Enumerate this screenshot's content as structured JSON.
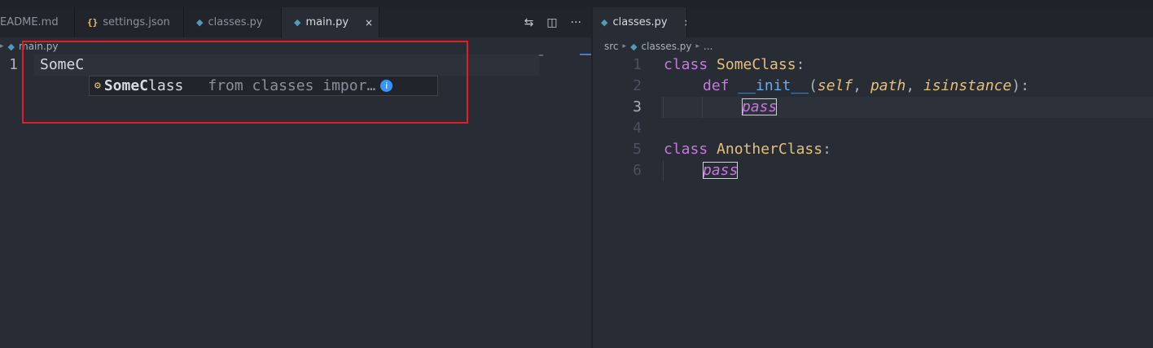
{
  "left_tabs": [
    {
      "label": "EADME.md",
      "icon": "markdown-icon"
    },
    {
      "label": "settings.json",
      "icon": "{}",
      "icon_name": "json-icon"
    },
    {
      "label": "classes.py",
      "icon": "python-icon"
    },
    {
      "label": "main.py",
      "icon": "python-icon",
      "active": true,
      "close": "×"
    }
  ],
  "left_actions": {
    "compare": "⇆",
    "split": "◫",
    "more": "···"
  },
  "right_tabs": [
    {
      "label": "classes.py",
      "icon": "python-icon",
      "active": true,
      "close": "×"
    }
  ],
  "left_breadcrumb": {
    "file": "main.py"
  },
  "right_breadcrumb": {
    "folder": "src",
    "file": "classes.py",
    "ellipsis": "..."
  },
  "left_editor": {
    "lines": [
      {
        "num": "1",
        "text": "SomeC"
      }
    ]
  },
  "suggestion": {
    "match": "SomeC",
    "rest": "lass",
    "detail": "from classes impor…",
    "info": "i"
  },
  "right_editor": {
    "line_numbers": [
      "1",
      "2",
      "3",
      "4",
      "5",
      "6"
    ],
    "l1": {
      "kw": "class",
      "name": "SomeClass",
      "colon": ":"
    },
    "l2": {
      "kw": "def",
      "fn": "__init__",
      "open": "(",
      "self": "self",
      "c1": ", ",
      "p1": "path",
      "c2": ", ",
      "p2": "isinstance",
      "close": "):"
    },
    "l3": {
      "kw": "pass"
    },
    "l5": {
      "kw": "class",
      "name": "AnotherClass",
      "colon": ":"
    },
    "l6": {
      "kw": "pass"
    }
  },
  "colors": {
    "keyword": "#c678dd",
    "class": "#e5c07b",
    "function": "#61afef",
    "highlight": "#e51c23"
  }
}
